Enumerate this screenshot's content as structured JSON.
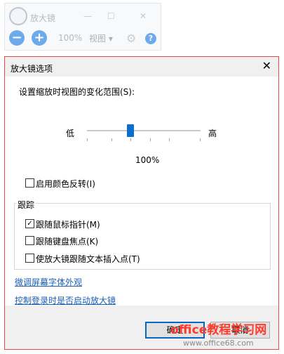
{
  "magnifier": {
    "title": "放大镜",
    "minimize": "—",
    "maximize": "☐",
    "close": "✕",
    "zoom_out": "−",
    "zoom_in": "+",
    "zoom_level": "100%",
    "views_label": "视图 ▾",
    "settings_icon": "gear-icon",
    "help_icon": "help-icon",
    "help": "?"
  },
  "dialog": {
    "title": "放大镜选项",
    "close": "✕",
    "zoom_range_label": "设置缩放时视图的变化范围(S):",
    "slider_low": "低",
    "slider_high": "高",
    "slider_value": "100%",
    "invert_colors": "启用颜色反转(I)",
    "invert_checked": false,
    "tracking_group": "跟踪",
    "follow_mouse": "跟随鼠标指针(M)",
    "follow_mouse_checked": true,
    "follow_keyboard": "跟随键盘焦点(K)",
    "follow_keyboard_checked": false,
    "follow_text": "使放大镜跟随文本插入点(T)",
    "follow_text_checked": false,
    "link_cleartype": "微调屏幕字体外观",
    "link_logon": "控制登录时是否启动放大镜",
    "ok": "确定",
    "cancel": "取消"
  },
  "watermark": {
    "text": "office教程学习网",
    "url": "www.office68.com"
  },
  "colors": {
    "accent": "#0b6ed1",
    "dialog_border": "#e34a4a",
    "watermark": "#ff3a2a"
  }
}
